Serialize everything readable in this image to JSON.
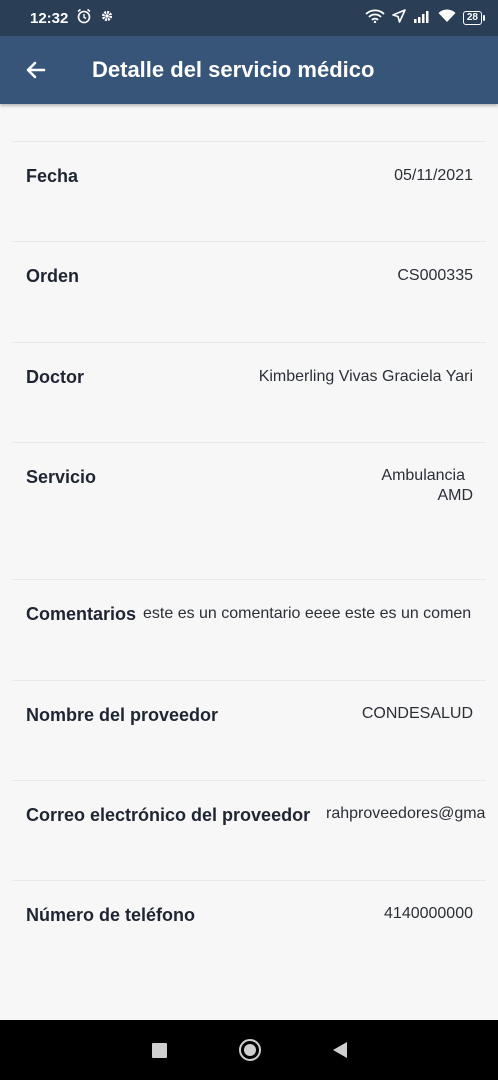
{
  "status_bar": {
    "time": "12:32",
    "battery": "28"
  },
  "app_bar": {
    "title": "Detalle del servicio médico"
  },
  "details": {
    "fecha": {
      "label": "Fecha",
      "value": "05/11/2021"
    },
    "orden": {
      "label": "Orden",
      "value": "CS000335"
    },
    "doctor": {
      "label": "Doctor",
      "value": "Kimberling Vivas Graciela Yari"
    },
    "servicio": {
      "label": "Servicio",
      "value_line1": "Ambulancia",
      "value_line2": "AMD"
    },
    "comentarios": {
      "label": "Comentarios",
      "value": "este es un comentario eeee este es un comen"
    },
    "proveedor": {
      "label": "Nombre del proveedor",
      "value": "CONDESALUD"
    },
    "correo": {
      "label": "Correo electrónico del proveedor",
      "value": "rahproveedores@gma"
    },
    "telefono": {
      "label": "Número de teléfono",
      "value": "4140000000"
    }
  },
  "colors": {
    "app_bar": "#365579",
    "status_bar": "#2a3e56",
    "background": "#f7f7f7"
  }
}
